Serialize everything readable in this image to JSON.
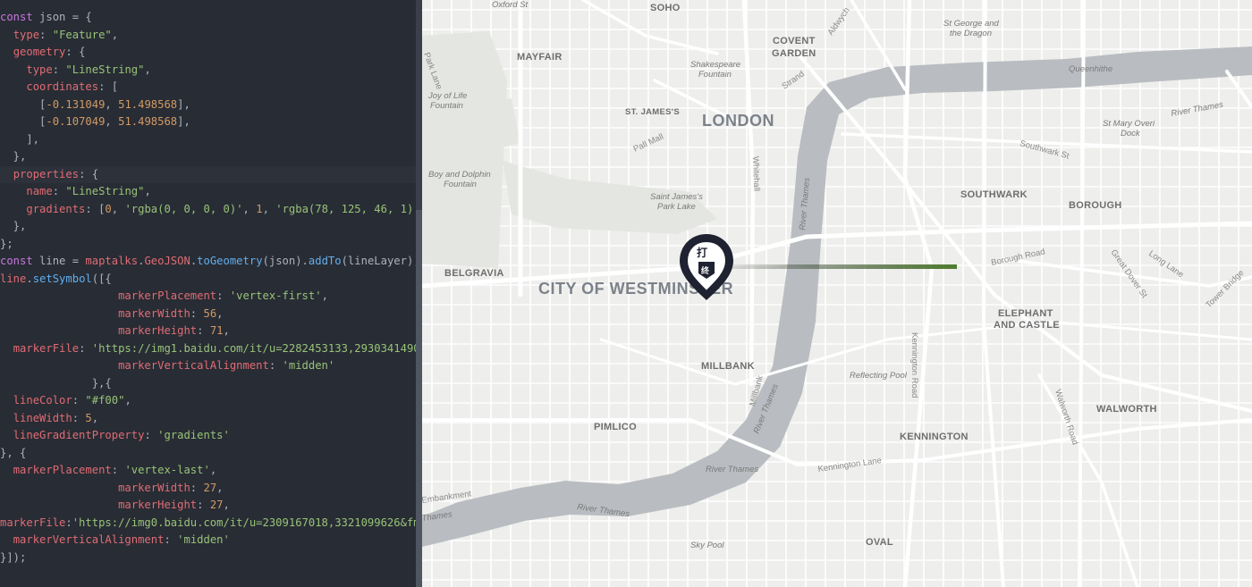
{
  "editor": {
    "lines": [
      [
        [
          "k",
          "const"
        ],
        [
          "t",
          " json = {"
        ]
      ],
      [
        [
          "t",
          "  "
        ],
        [
          "p",
          "type"
        ],
        [
          "t",
          ": "
        ],
        [
          "s",
          "\"Feature\""
        ],
        [
          "t",
          ","
        ]
      ],
      [
        [
          "t",
          "  "
        ],
        [
          "p",
          "geometry"
        ],
        [
          "t",
          ": {"
        ]
      ],
      [
        [
          "t",
          "    "
        ],
        [
          "p",
          "type"
        ],
        [
          "t",
          ": "
        ],
        [
          "s",
          "\"LineString\""
        ],
        [
          "t",
          ","
        ]
      ],
      [
        [
          "t",
          "    "
        ],
        [
          "p",
          "coordinates"
        ],
        [
          "t",
          ": ["
        ]
      ],
      [
        [
          "t",
          "      ["
        ],
        [
          "n",
          "-0.131049"
        ],
        [
          "t",
          ", "
        ],
        [
          "n",
          "51.498568"
        ],
        [
          "t",
          "],"
        ]
      ],
      [
        [
          "t",
          "      ["
        ],
        [
          "n",
          "-0.107049"
        ],
        [
          "t",
          ", "
        ],
        [
          "n",
          "51.498568"
        ],
        [
          "t",
          "],"
        ]
      ],
      [
        [
          "t",
          "    ],"
        ]
      ],
      [
        [
          "t",
          "  },"
        ]
      ],
      [
        [
          "t",
          "  "
        ],
        [
          "p",
          "properties"
        ],
        [
          "t",
          ": {"
        ]
      ],
      [
        [
          "t",
          "    "
        ],
        [
          "p",
          "name"
        ],
        [
          "t",
          ": "
        ],
        [
          "s",
          "\"LineString\""
        ],
        [
          "t",
          ","
        ]
      ],
      [
        [
          "t",
          "    "
        ],
        [
          "p",
          "gradients"
        ],
        [
          "t",
          ": ["
        ],
        [
          "n",
          "0"
        ],
        [
          "t",
          ", "
        ],
        [
          "s",
          "'rgba(0, 0, 0, 0)'"
        ],
        [
          "t",
          ", "
        ],
        [
          "n",
          "1"
        ],
        [
          "t",
          ", "
        ],
        [
          "s",
          "'rgba(78, 125, 46, 1)'"
        ]
      ],
      [
        [
          "t",
          "  },"
        ]
      ],
      [
        [
          "t",
          "};"
        ]
      ],
      [
        [
          "k",
          "const"
        ],
        [
          "t",
          " line = "
        ],
        [
          "p",
          "maptalks"
        ],
        [
          "t",
          "."
        ],
        [
          "p",
          "GeoJSON"
        ],
        [
          "t",
          "."
        ],
        [
          "f",
          "toGeometry"
        ],
        [
          "t",
          "(json)."
        ],
        [
          "f",
          "addTo"
        ],
        [
          "t",
          "(lineLayer);"
        ]
      ],
      [
        [
          "p",
          "line"
        ],
        [
          "t",
          "."
        ],
        [
          "f",
          "setSymbol"
        ],
        [
          "t",
          "([{"
        ]
      ],
      [
        [
          "t",
          "                  "
        ],
        [
          "p",
          "markerPlacement"
        ],
        [
          "t",
          ": "
        ],
        [
          "s",
          "'vertex-first'"
        ],
        [
          "t",
          ","
        ]
      ],
      [
        [
          "t",
          "                  "
        ],
        [
          "p",
          "markerWidth"
        ],
        [
          "t",
          ": "
        ],
        [
          "n",
          "56"
        ],
        [
          "t",
          ","
        ]
      ],
      [
        [
          "t",
          "                  "
        ],
        [
          "p",
          "markerHeight"
        ],
        [
          "t",
          ": "
        ],
        [
          "n",
          "71"
        ],
        [
          "t",
          ","
        ]
      ],
      [
        [
          "t",
          "  "
        ],
        [
          "p",
          "markerFile"
        ],
        [
          "t",
          ": "
        ],
        [
          "s",
          "'https://img1.baidu.com/it/u=2282453133,2930341490&fm=253'"
        ]
      ],
      [
        [
          "t",
          "                  "
        ],
        [
          "p",
          "markerVerticalAlignment"
        ],
        [
          "t",
          ": "
        ],
        [
          "s",
          "'midden'"
        ]
      ],
      [
        [
          "t",
          "              },{"
        ]
      ],
      [
        [
          "t",
          "  "
        ],
        [
          "p",
          "lineColor"
        ],
        [
          "t",
          ": "
        ],
        [
          "s",
          "\"#f00\""
        ],
        [
          "t",
          ","
        ]
      ],
      [
        [
          "t",
          "  "
        ],
        [
          "p",
          "lineWidth"
        ],
        [
          "t",
          ": "
        ],
        [
          "n",
          "5"
        ],
        [
          "t",
          ","
        ]
      ],
      [
        [
          "t",
          "  "
        ],
        [
          "p",
          "lineGradientProperty"
        ],
        [
          "t",
          ": "
        ],
        [
          "s",
          "'gradients'"
        ]
      ],
      [
        [
          "t",
          "}, {"
        ]
      ],
      [
        [
          "t",
          "  "
        ],
        [
          "p",
          "markerPlacement"
        ],
        [
          "t",
          ": "
        ],
        [
          "s",
          "'vertex-last'"
        ],
        [
          "t",
          ","
        ]
      ],
      [
        [
          "t",
          "                  "
        ],
        [
          "p",
          "markerWidth"
        ],
        [
          "t",
          ": "
        ],
        [
          "n",
          "27"
        ],
        [
          "t",
          ","
        ]
      ],
      [
        [
          "t",
          "                  "
        ],
        [
          "p",
          "markerHeight"
        ],
        [
          "t",
          ": "
        ],
        [
          "n",
          "27"
        ],
        [
          "t",
          ","
        ]
      ],
      [
        [
          "p",
          "markerFile"
        ],
        [
          "t",
          ":"
        ],
        [
          "s",
          "'https://img0.baidu.com/it/u=2309167018,3321099626&fm=253'"
        ]
      ],
      [
        [
          "t",
          "  "
        ],
        [
          "p",
          "markerVerticalAlignment"
        ],
        [
          "t",
          ": "
        ],
        [
          "s",
          "'midden'"
        ]
      ],
      [
        [
          "t",
          "}]);"
        ]
      ]
    ],
    "active_line": 9
  },
  "map": {
    "labels": {
      "soho": "SOHO",
      "oxford": "Oxford St",
      "mayfair": "MAYFAIR",
      "covent": "COVENT",
      "garden": "GARDEN",
      "shakespeare1": "Shakespeare",
      "shakespeare2": "Fountain",
      "aldwych": "Aldwych",
      "stgeorge1": "St George and",
      "stgeorge2": "the Dragon",
      "queenhithe": "Queenhithe",
      "parklane": "Park Lane",
      "joyoflife1": "Joy of Life",
      "joyoflife2": "Fountain",
      "stjames": "ST. JAMES'S",
      "london": "LONDON",
      "strand": "Strand",
      "stmaryovery1": "St Mary Overi",
      "stmaryovery2": "Dock",
      "riverthames_ne": "River Thames",
      "pallmall": "Pall Mall",
      "southwarkst": "Southwark St",
      "boydolphin1": "Boy and Dolphin",
      "boydolphin2": "Fountain",
      "stjamespark1": "Saint James's",
      "stjamespark2": "Park Lake",
      "southwark": "SOUTHWARK",
      "borough": "BOROUGH",
      "whitehall": "Whitehall",
      "riverthames_v": "River Thames",
      "belgravia": "BELGRAVIA",
      "cityofwestminster": "CITY OF WESTMINSTER",
      "boroughroad": "Borough Road",
      "longlane": "Long Lane",
      "greatdover": "Great Dover St",
      "towerbridge": "Tower Bridge",
      "elephant1": "ELEPHANT",
      "elephant2": "AND CASTLE",
      "millbank": "MILLBANK",
      "reflecting": "Reflecting Pool",
      "kenningtonrd": "Kennington Road",
      "walworthrd": "Walworth Road",
      "walworth": "WALWORTH",
      "pimlico": "PIMLICO",
      "kennington": "KENNINGTON",
      "kenningtonlane": "Kennington Lane",
      "riverthames_s": "River Thames",
      "riverthames_sw": "River Thames",
      "millbank_rd": "Millbank",
      "embankment": "Embankment",
      "thames_w": "Thames",
      "skypool": "Sky Pool",
      "oval": "OVAL"
    },
    "line": {
      "start_color": "rgba(0, 0, 0, 0)",
      "end_color": "rgba(78, 125, 46, 1)"
    },
    "marker": {
      "glyph1": "打",
      "glyph2": "终"
    }
  }
}
